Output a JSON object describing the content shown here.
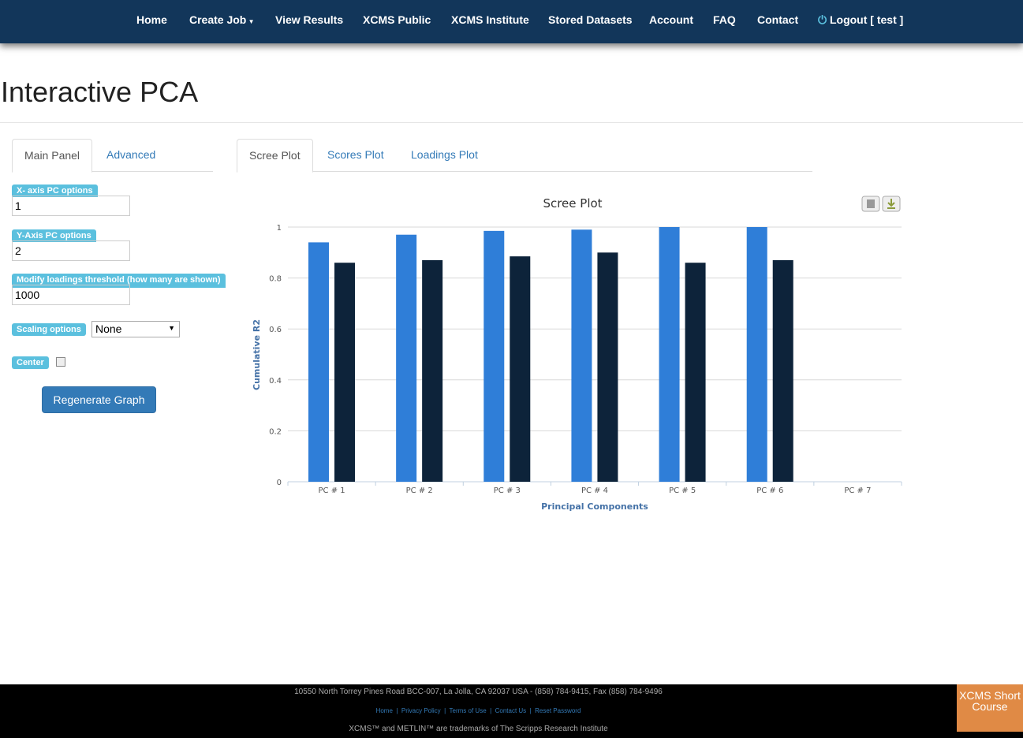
{
  "nav": {
    "items": [
      "Home",
      "Create Job",
      "View Results",
      "XCMS Public",
      "XCMS Institute",
      "Stored Datasets",
      "Account",
      "FAQ",
      "Contact",
      "Logout [ test ]"
    ]
  },
  "page_title": "Interactive PCA",
  "left_tabs": [
    "Main Panel",
    "Advanced"
  ],
  "right_tabs": [
    "Scree Plot",
    "Scores Plot",
    "Loadings Plot"
  ],
  "form": {
    "x_axis_label": "X- axis PC options",
    "x_axis_value": "1",
    "y_axis_label": "Y-Axis PC options",
    "y_axis_value": "2",
    "threshold_label": "Modify loadings threshold (how many are shown)",
    "threshold_value": "1000",
    "scaling_label": "Scaling options",
    "scaling_value": "None",
    "center_label": "Center",
    "center_checked": false,
    "regenerate_label": "Regenerate Graph"
  },
  "chart_data": {
    "type": "bar",
    "title": "Scree Plot",
    "xlabel": "Principal Components",
    "ylabel": "Cumulative R2",
    "categories": [
      "PC # 1",
      "PC # 2",
      "PC # 3",
      "PC # 4",
      "PC # 5",
      "PC # 6",
      "PC # 7"
    ],
    "series": [
      {
        "color": "#2f7ed8",
        "values": [
          0.94,
          0.97,
          0.985,
          0.99,
          1.0,
          1.0,
          null
        ]
      },
      {
        "color": "#0d233a",
        "values": [
          0.86,
          0.87,
          0.885,
          0.9,
          0.86,
          0.87,
          null
        ]
      }
    ],
    "ylim": [
      0,
      1
    ],
    "yticks": [
      "0",
      "0.2",
      "0.4",
      "0.6",
      "0.8",
      "1"
    ],
    "grid": true
  },
  "footer": {
    "address": "10550 North Torrey Pines Road BCC-007, La Jolla, CA 92037 USA - (858) 784-9415, Fax (858) 784-9496",
    "links": [
      "Home",
      "Privacy Policy",
      "Terms of Use",
      "Contact Us",
      "Reset Password"
    ],
    "trademark": "XCMS™ and METLIN™ are trademarks of The Scripps Research Institute",
    "badge": "XCMS Short Course"
  }
}
